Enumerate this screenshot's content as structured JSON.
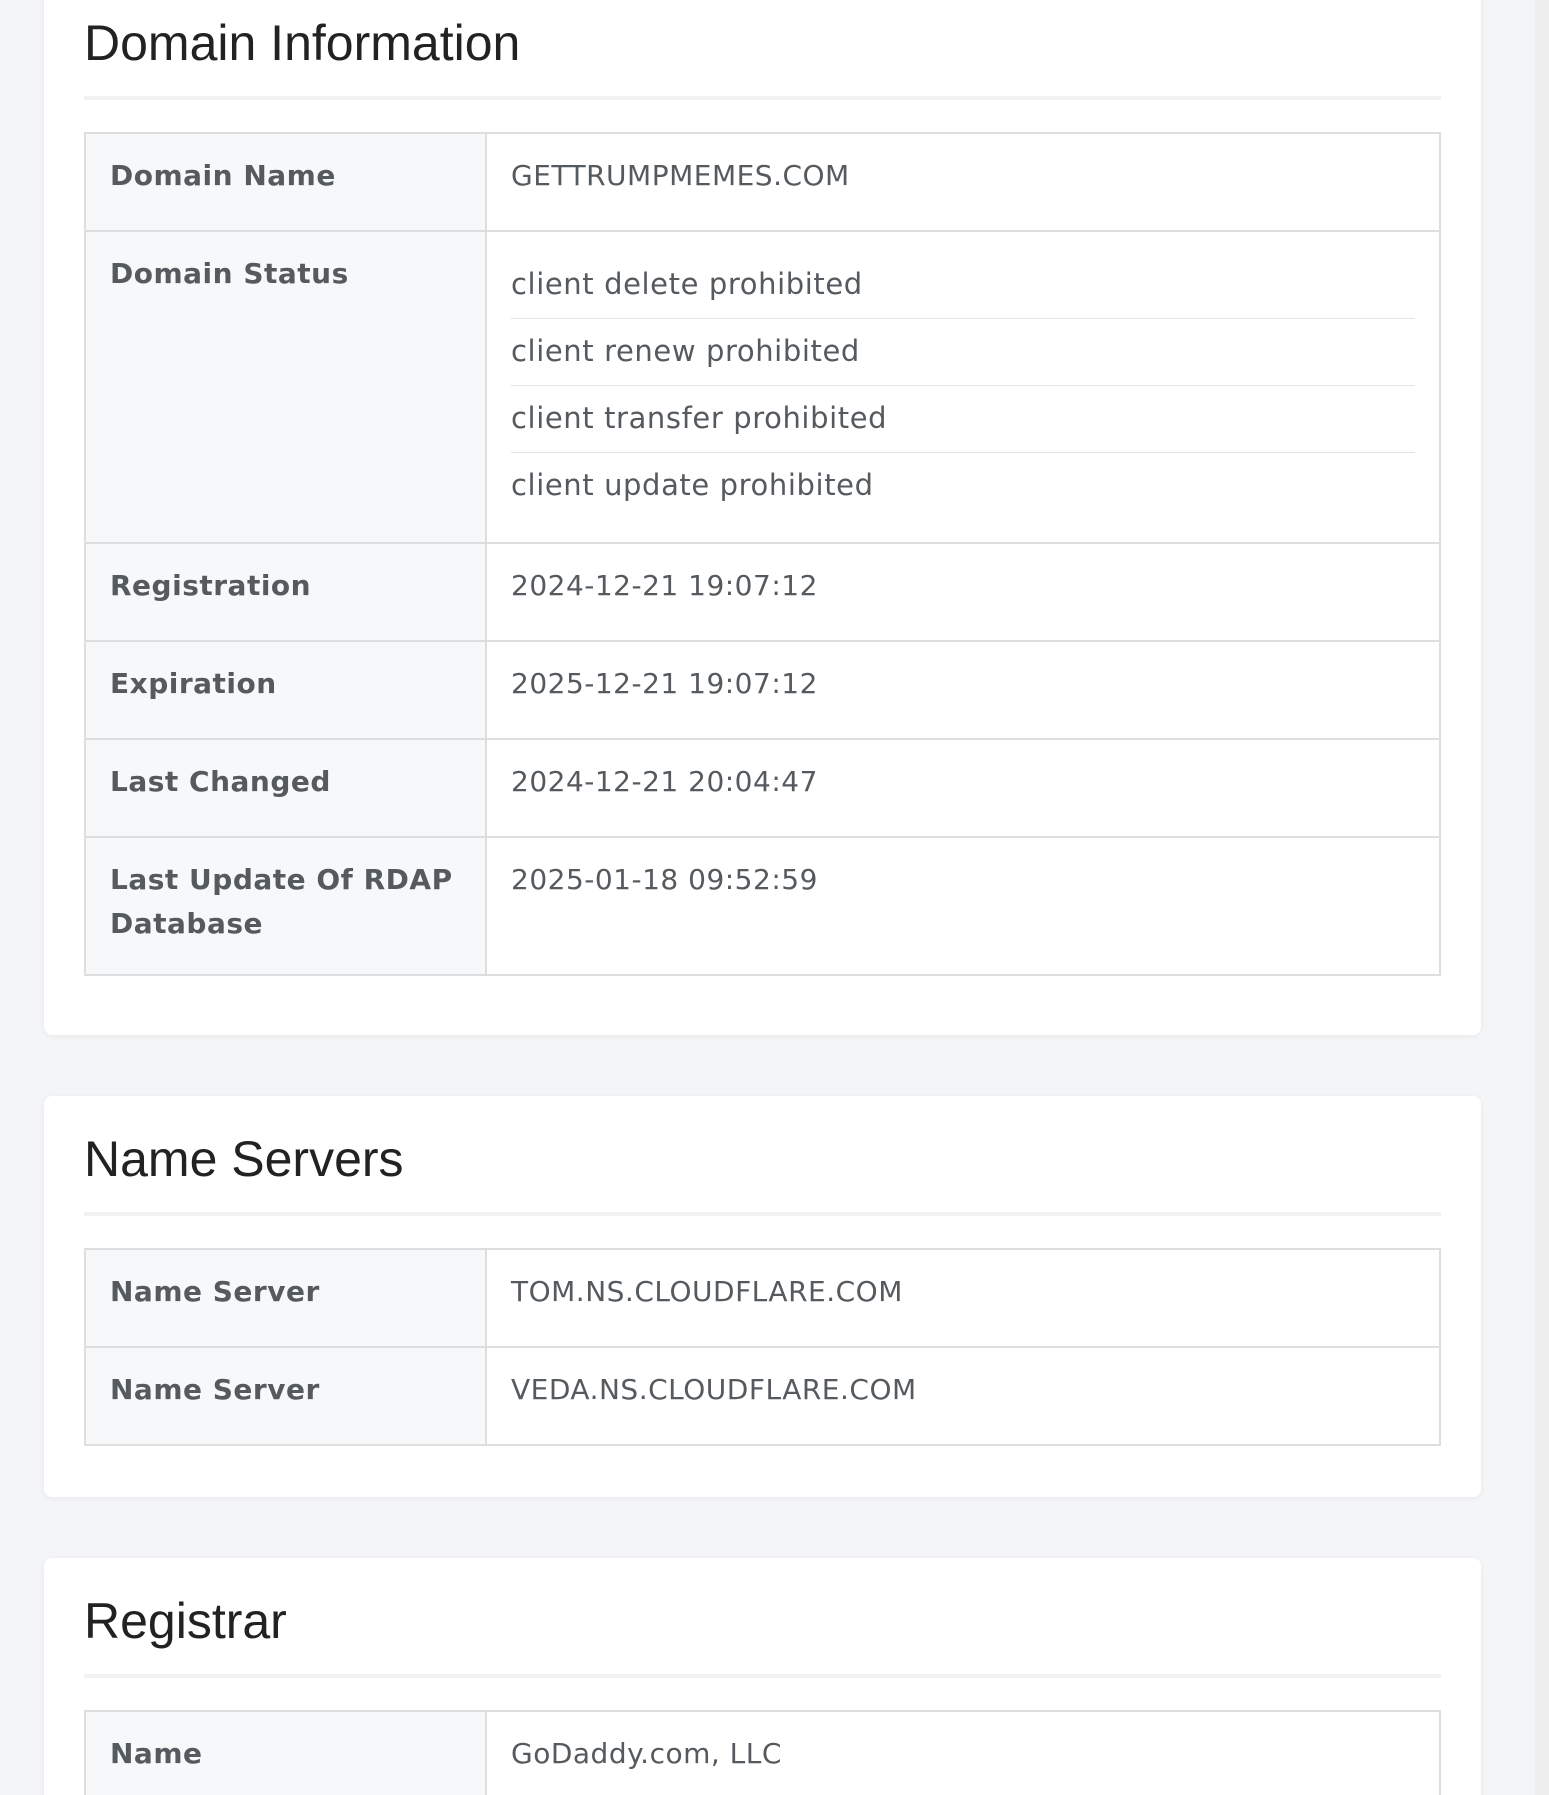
{
  "domain_information": {
    "title": "Domain Information",
    "rows": {
      "domain_name": {
        "label": "Domain Name",
        "value": "GETTRUMPMEMES.COM"
      },
      "domain_status": {
        "label": "Domain Status",
        "values": [
          "client delete prohibited",
          "client renew prohibited",
          "client transfer prohibited",
          "client update prohibited"
        ]
      },
      "registration": {
        "label": "Registration",
        "value": "2024-12-21 19:07:12"
      },
      "expiration": {
        "label": "Expiration",
        "value": "2025-12-21 19:07:12"
      },
      "last_changed": {
        "label": "Last Changed",
        "value": "2024-12-21 20:04:47"
      },
      "last_update_rdap": {
        "label": "Last Update Of RDAP Database",
        "value": "2025-01-18 09:52:59"
      }
    }
  },
  "name_servers": {
    "title": "Name Servers",
    "rows": [
      {
        "label": "Name Server",
        "value": "TOM.NS.CLOUDFLARE.COM"
      },
      {
        "label": "Name Server",
        "value": "VEDA.NS.CLOUDFLARE.COM"
      }
    ]
  },
  "registrar": {
    "title": "Registrar",
    "rows": [
      {
        "label": "Name",
        "value": "GoDaddy.com, LLC"
      }
    ]
  }
}
